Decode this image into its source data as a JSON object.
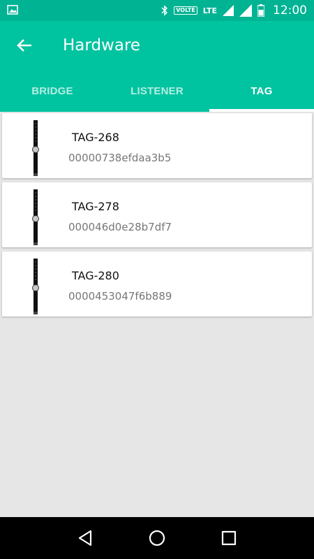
{
  "status_bar": {
    "time": "12:00",
    "volte": "VOLTE",
    "lte": "LTE",
    "icons": [
      "image-icon",
      "bluetooth-icon",
      "signal-icon",
      "signal-icon",
      "battery-icon"
    ]
  },
  "app_bar": {
    "title": "Hardware",
    "back_icon": "arrow-back-icon"
  },
  "tabs": [
    {
      "label": "BRIDGE",
      "active": false
    },
    {
      "label": "LISTENER",
      "active": false
    },
    {
      "label": "TAG",
      "active": true
    }
  ],
  "tags": [
    {
      "name": "TAG-268",
      "mac": "00000738efdaa3b5",
      "icon": "tag-band-icon"
    },
    {
      "name": "TAG-278",
      "mac": "000046d0e28b7df7",
      "icon": "tag-band-icon"
    },
    {
      "name": "TAG-280",
      "mac": "0000453047f6b889",
      "icon": "tag-band-icon"
    }
  ],
  "nav_bar": {
    "buttons": [
      "back-triangle-icon",
      "home-circle-icon",
      "recents-square-icon"
    ]
  },
  "colors": {
    "status_bar": "#00b393",
    "primary": "#00c3a0",
    "background": "#e6e6e6"
  }
}
